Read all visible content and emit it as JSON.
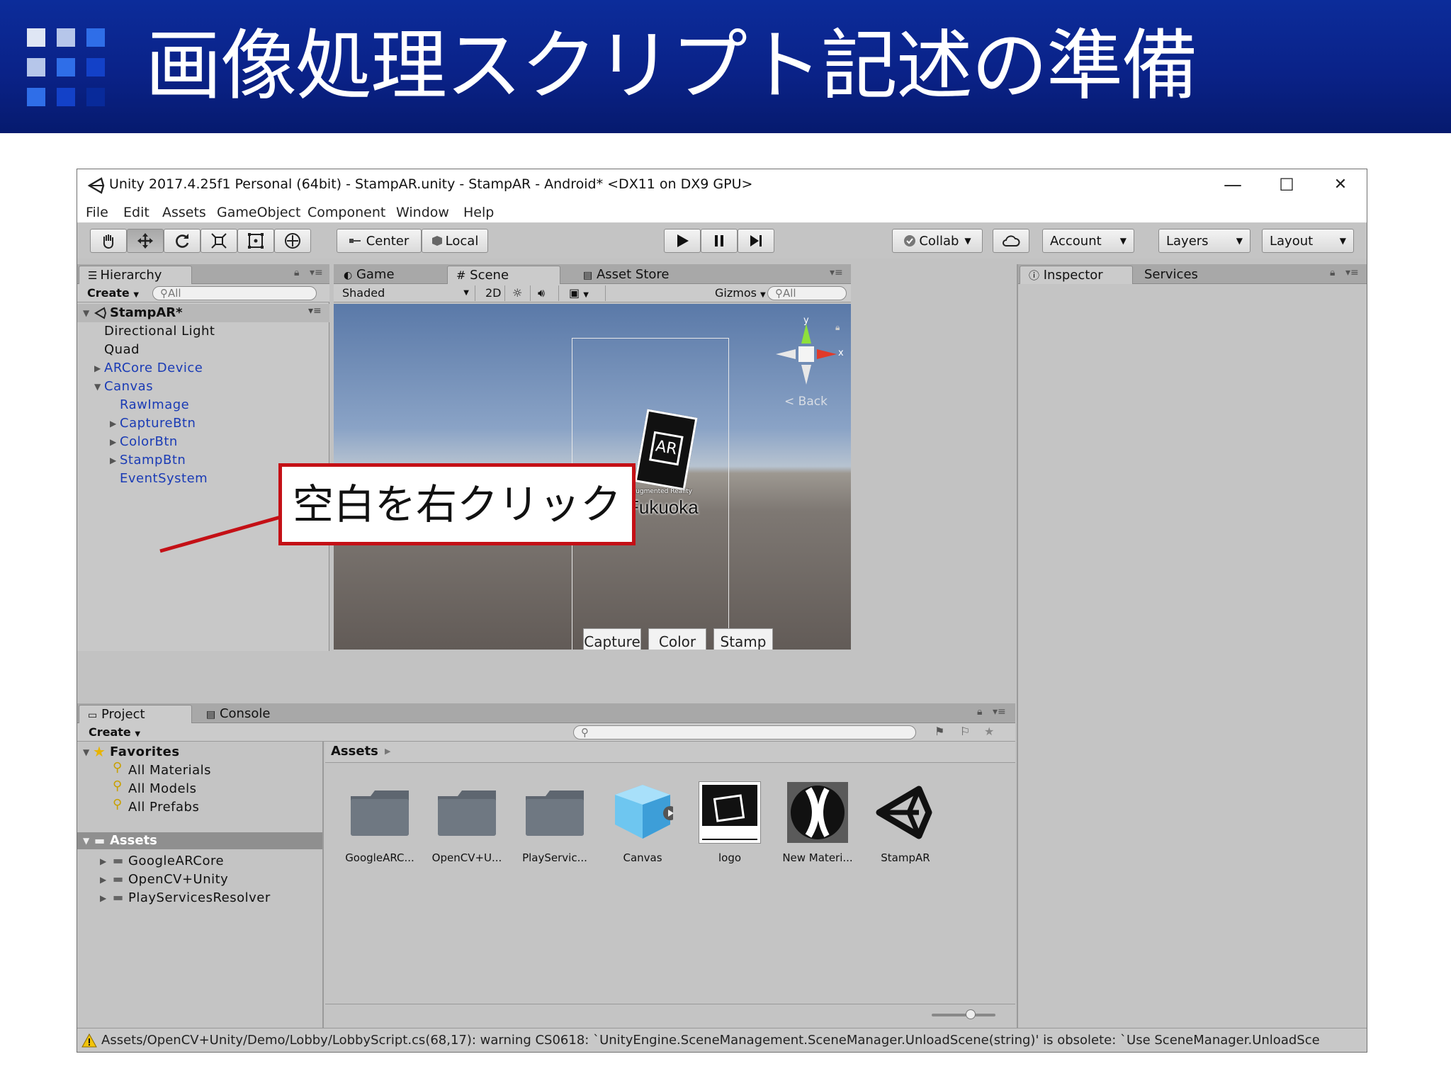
{
  "slide": {
    "title": "画像処理スクリプト記述の準備",
    "callout_text": "空白を右クリック",
    "colors": {
      "banner": "#0a2288",
      "callout_border": "#c41016"
    }
  },
  "window": {
    "title": "Unity 2017.4.25f1 Personal (64bit) - StampAR.unity - StampAR - Android* <DX11 on DX9 GPU>",
    "controls": {
      "minimize": "—",
      "maximize": "☐",
      "close": "✕"
    }
  },
  "menu": [
    "File",
    "Edit",
    "Assets",
    "GameObject",
    "Component",
    "Window",
    "Help"
  ],
  "toolbar": {
    "tools": [
      "hand-icon",
      "move-icon",
      "rotate-icon",
      "scale-icon",
      "rect-icon",
      "transform-icon"
    ],
    "pivot": "Center",
    "space": "Local",
    "collab": "Collab",
    "account": "Account",
    "layers": "Layers",
    "layout": "Layout"
  },
  "hierarchy": {
    "tab": "Hierarchy",
    "create": "Create",
    "search_placeholder": "All",
    "scene_name": "StampAR*",
    "items": [
      {
        "label": "Directional Light"
      },
      {
        "label": "Quad"
      },
      {
        "label": "ARCore Device"
      },
      {
        "label": "Canvas"
      },
      {
        "label": "RawImage"
      },
      {
        "label": "CaptureBtn"
      },
      {
        "label": "ColorBtn"
      },
      {
        "label": "StampBtn"
      },
      {
        "label": "EventSystem"
      }
    ]
  },
  "scene": {
    "tabs": {
      "game": "Game",
      "scene": "Scene",
      "store": "Asset Store"
    },
    "shading": "Shaded",
    "mode_2d": "2D",
    "gizmos": "Gizmos",
    "search_placeholder": "All",
    "gizmo_back": "Back",
    "axis_y": "y",
    "axis_x": "x",
    "marker": {
      "ar": "AR",
      "sub": "Augmented Reality",
      "name": "Fukuoka"
    },
    "buttons": [
      "Capture",
      "Color",
      "Stamp"
    ]
  },
  "inspector": {
    "tab": "Inspector",
    "services": "Services"
  },
  "project": {
    "tab": "Project",
    "console": "Console",
    "create": "Create",
    "favorites": "Favorites",
    "favorite_items": [
      "All Materials",
      "All Models",
      "All Prefabs"
    ],
    "assets_root": "Assets",
    "asset_folders": [
      "GoogleARCore",
      "OpenCV+Unity",
      "PlayServicesResolver"
    ],
    "breadcrumb": "Assets",
    "assets": [
      {
        "label": "GoogleARC..."
      },
      {
        "label": "OpenCV+U..."
      },
      {
        "label": "PlayServic..."
      },
      {
        "label": "Canvas"
      },
      {
        "label": "logo"
      },
      {
        "label": "New Materi..."
      },
      {
        "label": "StampAR"
      }
    ]
  },
  "status": {
    "message": "Assets/OpenCV+Unity/Demo/Lobby/LobbyScript.cs(68,17): warning CS0618: `UnityEngine.SceneManagement.SceneManager.UnloadScene(string)' is obsolete: `Use SceneManager.UnloadSce"
  }
}
